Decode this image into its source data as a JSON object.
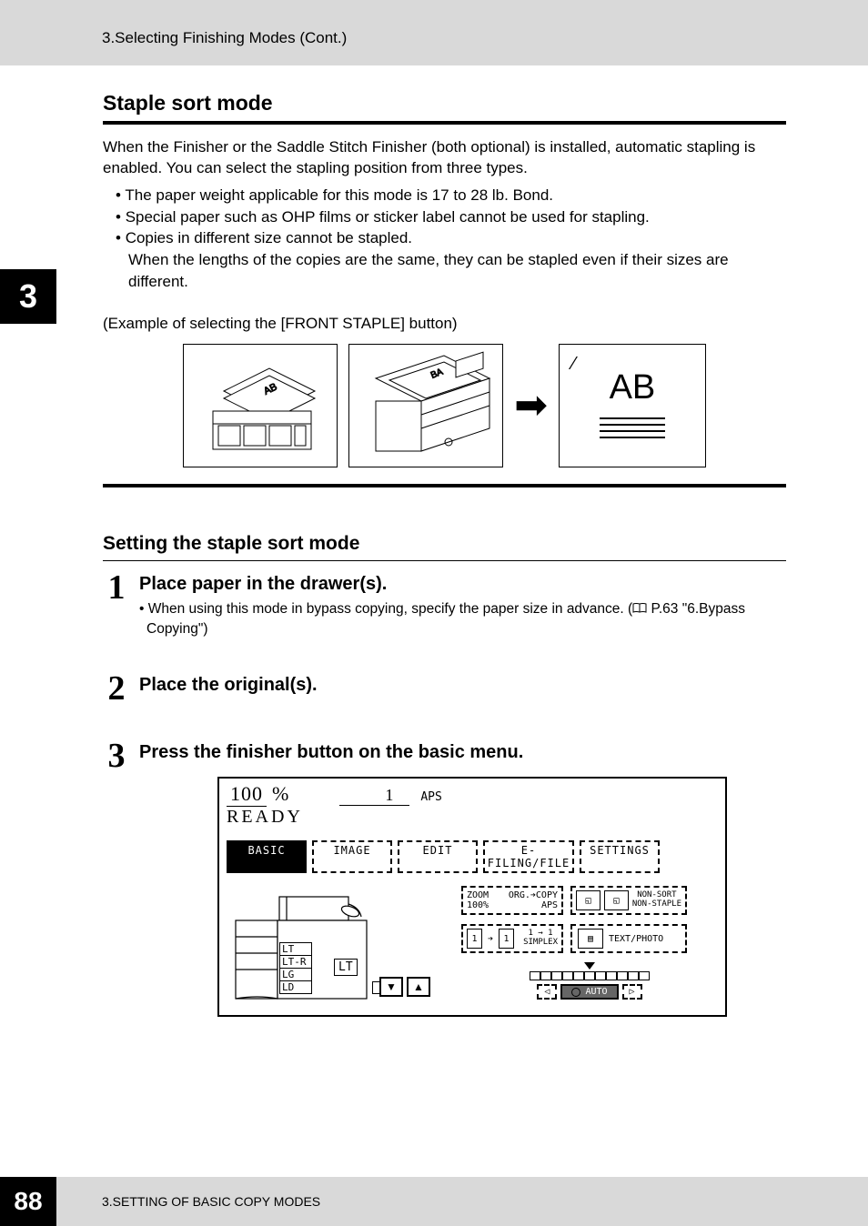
{
  "header": {
    "breadcrumb": "3.Selecting Finishing Modes (Cont.)"
  },
  "side_tab": "3",
  "section": {
    "title": "Staple sort mode",
    "intro": "When the Finisher or the Saddle Stitch Finisher (both optional) is installed, automatic stapling is enabled. You can select the stapling position from three types.",
    "bullets": [
      "The paper weight applicable for this mode is 17 to 28 lb. Bond.",
      "Special paper such as OHP films or sticker label cannot be used for stapling.",
      "Copies in different size cannot be stapled."
    ],
    "bullet3_cont": "When the lengths of the copies are the same, they can be stapled even if their sizes are different.",
    "example": "(Example of selecting the [FRONT STAPLE] button)",
    "ab_label": "AB"
  },
  "subsection": {
    "title": "Setting the staple sort mode",
    "steps": [
      {
        "num": "1",
        "title": "Place paper in the drawer(s).",
        "note_prefix": "When using this mode in bypass copying, specify the paper size in advance. (",
        "note_ref": " P.63 \"6.Bypass Copying\")"
      },
      {
        "num": "2",
        "title": "Place the original(s)."
      },
      {
        "num": "3",
        "title": "Press the finisher button on the basic menu."
      }
    ]
  },
  "screenshot": {
    "percent": "100",
    "percent_unit": "%",
    "qty": "1",
    "mode_label": "APS",
    "status": "READY",
    "tabs": [
      "BASIC",
      "IMAGE",
      "EDIT",
      "E-FILING/FILE",
      "SETTINGS"
    ],
    "trays": [
      "LT",
      "LT-R",
      "LG",
      "LD"
    ],
    "paper_sel": "LT",
    "zoom": {
      "l1": "ZOOM",
      "l2": "100%",
      "r1": "ORG.➔COPY",
      "r2": "APS"
    },
    "nonsort": "NON-SORT\nNON-STAPLE",
    "simplex": {
      "arrow": "1 → 1",
      "label": "SIMPLEX"
    },
    "textphoto": "TEXT/PHOTO",
    "density": {
      "left": "◁",
      "auto": "AUTO",
      "right": "▷"
    }
  },
  "footer": {
    "page": "88",
    "text": "3.SETTING OF BASIC COPY MODES"
  }
}
